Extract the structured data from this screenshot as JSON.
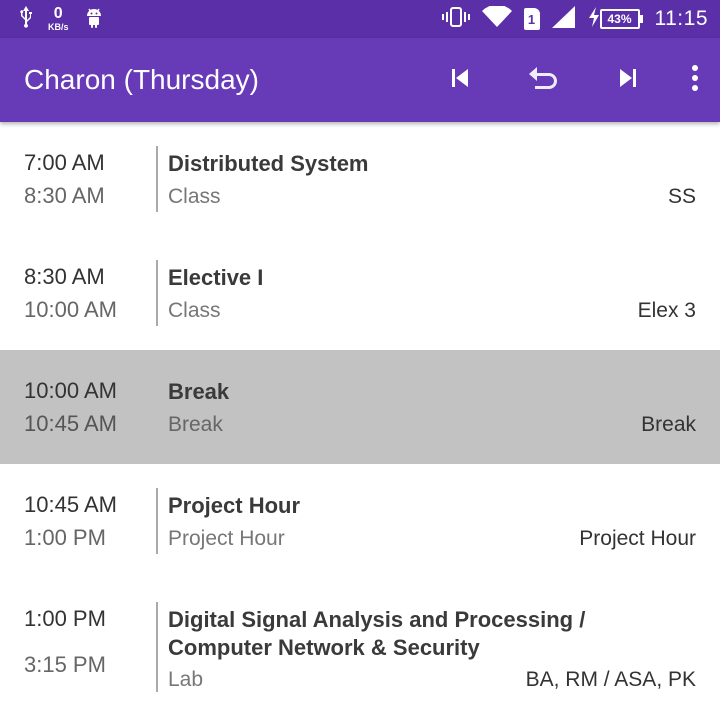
{
  "statusbar": {
    "net_speed_value": "0",
    "net_speed_unit": "KB/s",
    "sim_label": "1",
    "battery_percent": "43%",
    "time": "11:15",
    "icons": [
      "usb-icon",
      "android-icon",
      "vibrate-icon",
      "wifi-icon",
      "sim-icon",
      "signal-icon",
      "charging-icon",
      "battery-icon"
    ]
  },
  "appbar": {
    "title": "Charon (Thursday)",
    "actions": [
      "skip-previous-icon",
      "undo-icon",
      "skip-next-icon",
      "more-vert-icon"
    ]
  },
  "colors": {
    "statusbar": "#5b2fa8",
    "appbar": "#673ab7",
    "highlight_row": "#c2c2c2"
  },
  "schedule": [
    {
      "start": "7:00 AM",
      "end": "8:30 AM",
      "title": "Distributed System",
      "kind": "Class",
      "room": "SS",
      "highlighted": false
    },
    {
      "start": "8:30 AM",
      "end": "10:00 AM",
      "title": "Elective I",
      "kind": "Class",
      "room": "Elex 3",
      "highlighted": false
    },
    {
      "start": "10:00 AM",
      "end": "10:45 AM",
      "title": "Break",
      "kind": "Break",
      "room": "Break",
      "highlighted": true
    },
    {
      "start": "10:45 AM",
      "end": "1:00 PM",
      "title": "Project Hour",
      "kind": "Project Hour",
      "room": "Project Hour",
      "highlighted": false
    },
    {
      "start": "1:00 PM",
      "end": "3:15 PM",
      "title_line1": "Digital Signal Analysis and Processing /",
      "title_line2": "Computer Network & Security",
      "kind": "Lab",
      "room": "BA, RM / ASA, PK",
      "highlighted": false
    }
  ]
}
